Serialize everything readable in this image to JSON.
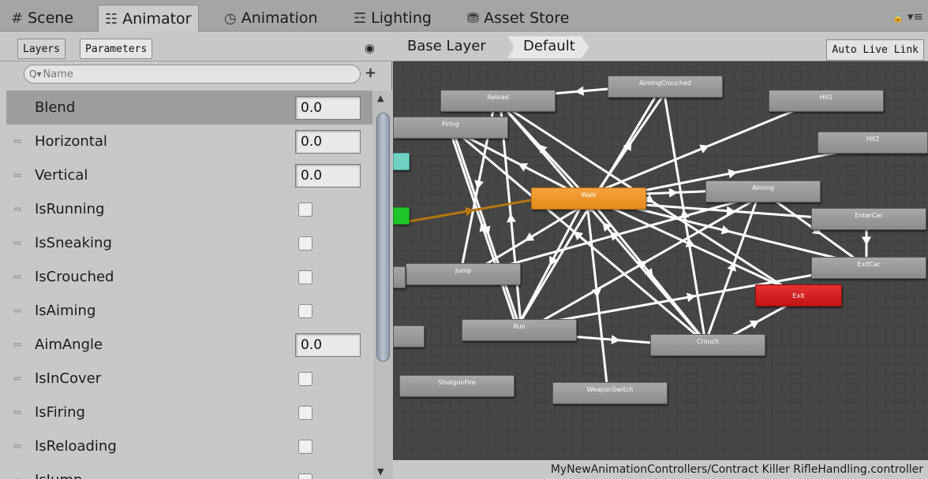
{
  "tabs": [
    {
      "icon": "#",
      "icon_name": "scene-grid-icon",
      "label": "Scene"
    },
    {
      "icon": "☷",
      "icon_name": "animator-icon",
      "label": "Animator"
    },
    {
      "icon": "◷",
      "icon_name": "clock-icon",
      "label": "Animation"
    },
    {
      "icon": "☲",
      "icon_name": "lighting-icon",
      "label": "Lighting"
    },
    {
      "icon": "⛃",
      "icon_name": "store-bag-icon",
      "label": "Asset Store"
    }
  ],
  "window_controls": {
    "lock": "🔒",
    "menu": "▾≡"
  },
  "left": {
    "subtabs": [
      "Layers",
      "Parameters"
    ],
    "eye_icon": "◉",
    "search_placeholder": "Name",
    "search_icon": "Q▾",
    "add_icon": "+",
    "drag_handle": "═",
    "params": [
      {
        "name": "Blend",
        "type": "float",
        "value": "0.0",
        "selected": true
      },
      {
        "name": "Horizontal",
        "type": "float",
        "value": "0.0"
      },
      {
        "name": "Vertical",
        "type": "float",
        "value": "0.0"
      },
      {
        "name": "IsRunning",
        "type": "bool",
        "value": false
      },
      {
        "name": "IsSneaking",
        "type": "bool",
        "value": false
      },
      {
        "name": "IsCrouched",
        "type": "bool",
        "value": false
      },
      {
        "name": "IsAiming",
        "type": "bool",
        "value": false
      },
      {
        "name": "AimAngle",
        "type": "float",
        "value": "0.0"
      },
      {
        "name": "IsInCover",
        "type": "bool",
        "value": false
      },
      {
        "name": "IsFiring",
        "type": "bool",
        "value": false
      },
      {
        "name": "IsReloading",
        "type": "bool",
        "value": false
      },
      {
        "name": "IsJump",
        "type": "bool",
        "value": false
      }
    ],
    "scroll_up": "▲",
    "scroll_down": "▼"
  },
  "graph": {
    "breadcrumb": [
      "Base Layer",
      "Default"
    ],
    "auto_live_link": "Auto Live Link",
    "states": [
      {
        "id": "AimingCrouched",
        "label": "AimingCrouched"
      },
      {
        "id": "Reload",
        "label": "Reload"
      },
      {
        "id": "Hit1",
        "label": "Hit1"
      },
      {
        "id": "Firing",
        "label": "Firing"
      },
      {
        "id": "Hit2",
        "label": "Hit2"
      },
      {
        "id": "Aiming",
        "label": "Aiming"
      },
      {
        "id": "Walk",
        "label": "Walk",
        "default": true
      },
      {
        "id": "EnterCar",
        "label": "EnterCar"
      },
      {
        "id": "ExitCar",
        "label": "ExitCar"
      },
      {
        "id": "Jump",
        "label": "Jump"
      },
      {
        "id": "Exit",
        "label": "Exit",
        "exit": true
      },
      {
        "id": "Run",
        "label": "Run"
      },
      {
        "id": "Crouch",
        "label": "Crouch"
      },
      {
        "id": "ShotgunFire",
        "label": "ShotgunFire"
      },
      {
        "id": "WeaponSwitch",
        "label": "WeaponSwitch"
      },
      {
        "id": "Entry",
        "label": ""
      },
      {
        "id": "AnyState",
        "label": ""
      },
      {
        "id": "Sub1",
        "label": ""
      },
      {
        "id": "Sub2",
        "label": ""
      }
    ],
    "colors": {
      "default_state": "#f19628",
      "exit_state": "#d41e1e",
      "entry_state": "#1fc52a",
      "any_state": "#6fd1c4",
      "default_transition": "#b5770f",
      "transition": "#ffffff"
    }
  },
  "status_path": "MyNewAnimationControllers/Contract Killer RifleHandling.controller"
}
